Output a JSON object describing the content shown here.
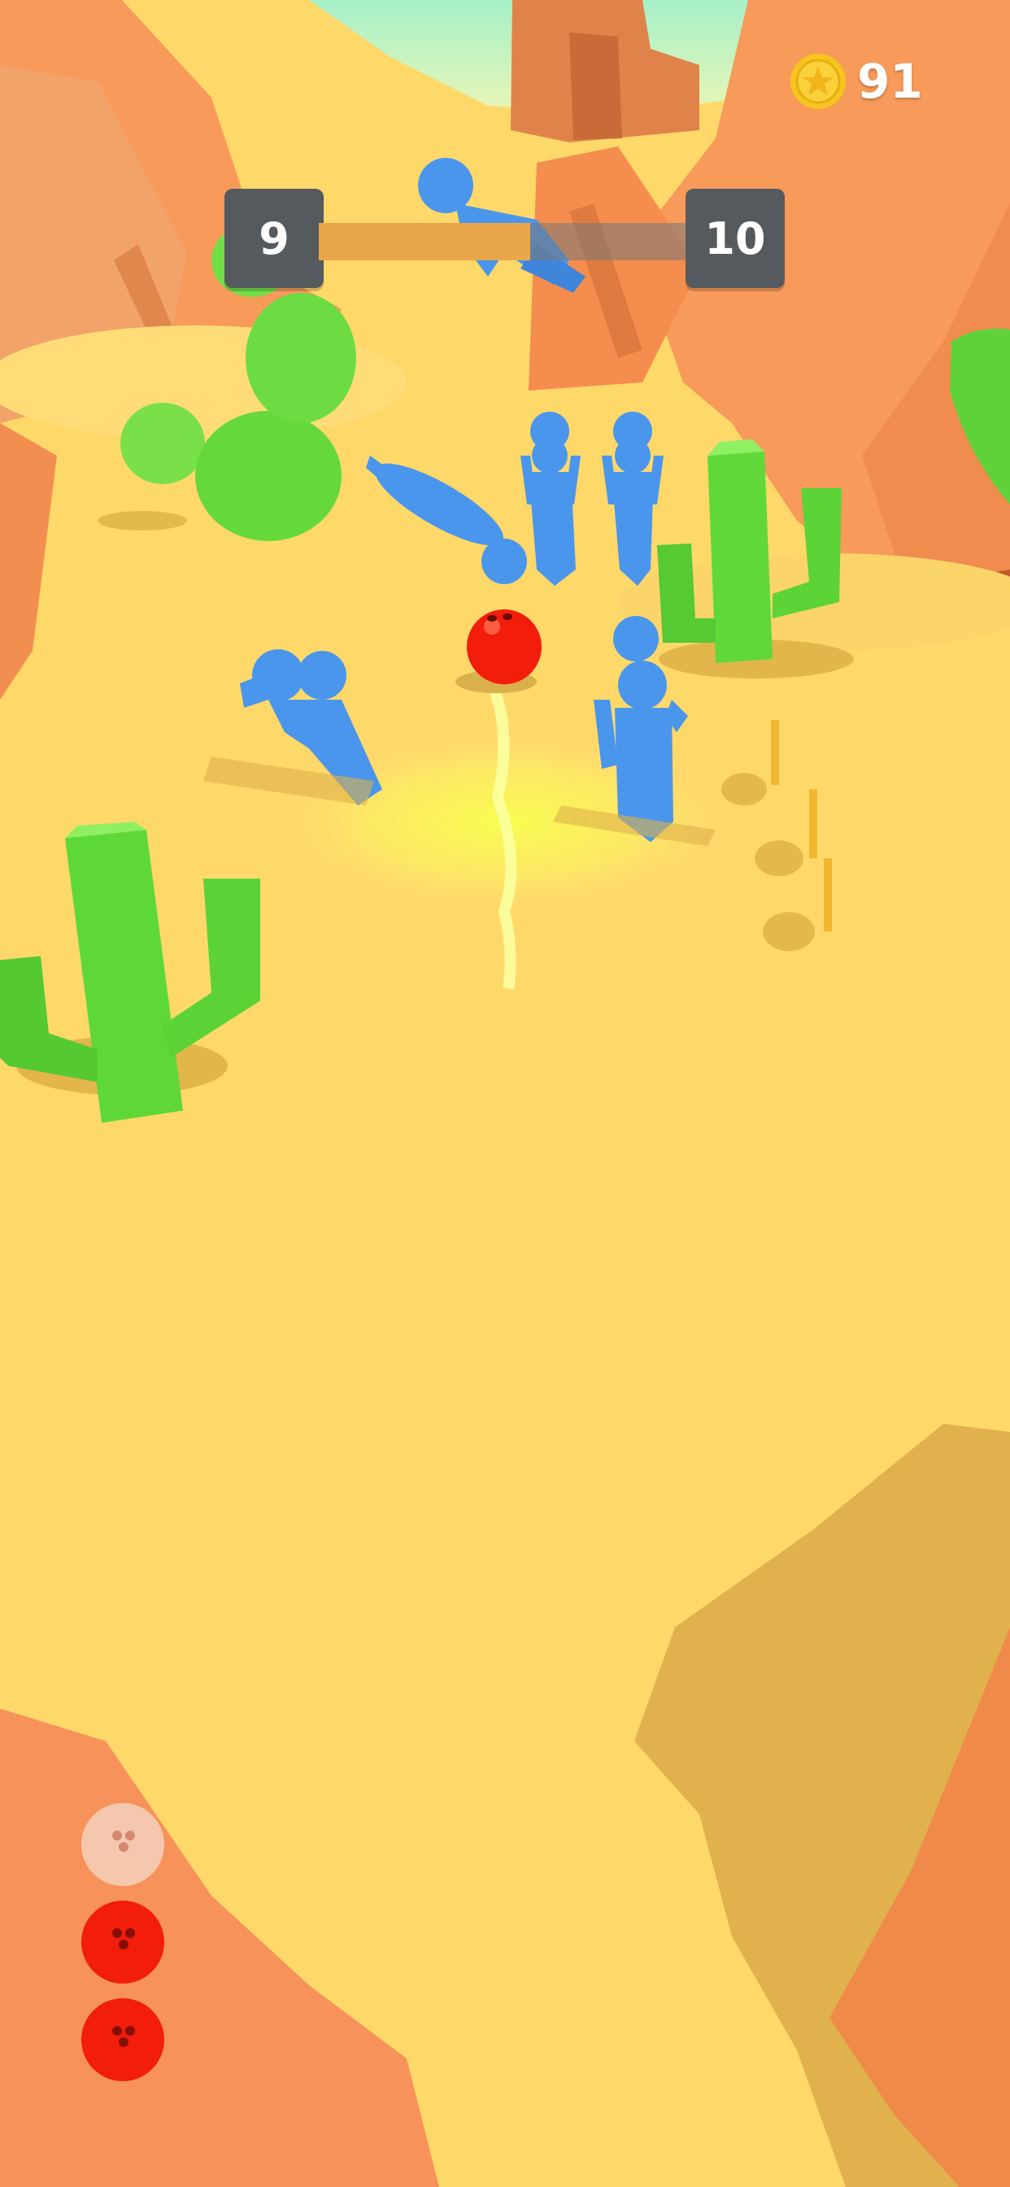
{
  "hud": {
    "level_current": "9",
    "level_next": "10",
    "level_progress": 0.57,
    "coins": "91"
  },
  "balls": {
    "total": 3,
    "used": 1
  },
  "colors": {
    "sand": "#ffd86a",
    "rock": "#f79a5a",
    "cactus": "#5fdc3c",
    "enemy": "#4a96ec",
    "ball": "#f31d0c",
    "progress_fill": "#eaa64a",
    "level_box": "#555a5e",
    "coin": "#f7c51e"
  },
  "icons": {
    "coin": "star-coin-icon",
    "ball": "bowling-ball-icon"
  }
}
